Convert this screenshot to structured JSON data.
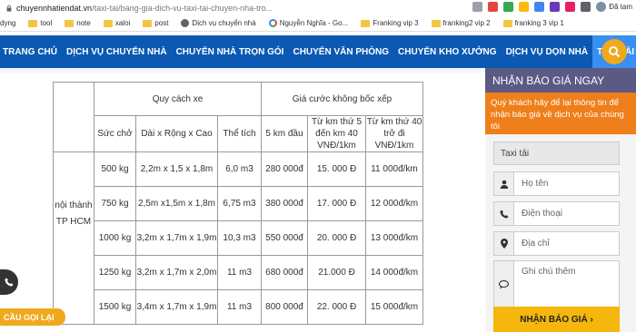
{
  "browser": {
    "url_host": "chuyennhatiendat.vn",
    "url_path": "/taxi-tai/bang-gia-dich-vu-taxi-tai-chuyen-nha-tro...",
    "profile_label": "Đã tạm",
    "bookmarks": [
      "dyng",
      "tool",
      "note",
      "xaloi",
      "post",
      "Dịch vụ chuyển nhà",
      "Nguyễn Nghĩa - Go...",
      "Franking vip 3",
      "franking2 vip 2",
      "franking 3 vip 1"
    ]
  },
  "nav": {
    "items": [
      "TRANG CHỦ",
      "DỊCH VỤ CHUYỂN NHÀ",
      "CHUYỂN NHÀ TRỌN GÓI",
      "CHUYỂN VĂN PHÒNG",
      "CHUYỂN KHO XƯỞNG",
      "DỊCH VỤ DỌN NHÀ",
      "TAXI TẢI"
    ]
  },
  "table": {
    "group1": "Quy cách xe",
    "group2": "Giá cước không bốc xếp",
    "cols": [
      "Sức chở",
      "Dài x Rộng x Cao",
      "Thể tích",
      "5 km đầu",
      "Từ km thứ 5 đến km 40 VNĐ/1km",
      "Từ km thứ 40 trở đi VNĐ/1km"
    ],
    "region_line1": "nội thành",
    "region_line2": "TP HCM",
    "rows": [
      [
        "500 kg",
        "2,2m x 1,5 x 1,8m",
        "6,0 m3",
        "280 000đ",
        "15. 000 Đ",
        "11 000đ/km"
      ],
      [
        "750 kg",
        "2,5m x1,5m x 1,8m",
        "6,75 m3",
        "380 000đ",
        "17. 000 Đ",
        "12 000đ/km"
      ],
      [
        "1000 kg",
        "3,2m x 1,7m x 1,9m",
        "10,3 m3",
        "550 000đ",
        "20. 000 Đ",
        "13 000đ/km"
      ],
      [
        "1250 kg",
        "3,2m x 1,7m x 2,0m",
        "11 m3",
        "680 000đ",
        "21.000 Đ",
        "14 000đ/km"
      ],
      [
        "1500 kg",
        "3,4m x 1,7m x 1,9m",
        "11 m3",
        "800 000đ",
        "22. 000 Đ",
        "15 000đ/km"
      ]
    ]
  },
  "sidebar": {
    "title": "NHẬN BÁO GIÁ NGAY",
    "note": "Quý khách hãy để lại thông tin để nhận báo giá về dịch vụ của chúng tôi",
    "service_value": "Taxi tải",
    "name_placeholder": "Họ tên",
    "phone_placeholder": "Điện thoại",
    "address_placeholder": "Địa chỉ",
    "notes_placeholder": "Ghi chú thêm",
    "submit_label": "NHẬN BÁO GIÁ ›"
  },
  "floating": {
    "call_label": "CẦU GỌI LẠI"
  },
  "colors": {
    "nav": "#0b59b3",
    "accent": "#f0a81c",
    "sidebar_head": "#5b5a84",
    "sidebar_note": "#ef7f1a"
  }
}
